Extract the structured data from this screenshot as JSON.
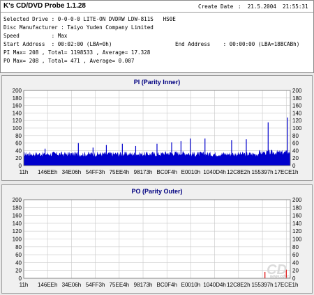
{
  "header": {
    "app_title": "K's CD/DVD Probe 1.1.28",
    "create_date_label": "Create Date",
    "create_date_value": ":  21.5.2004  21:55:31",
    "selected_drive": "Selected Drive : 0-0-0-0 LITE-ON DVDRW LDW-811S   HS0E",
    "disc_manufacturer": "Disc Manufacturer : Taiyo Yuden Company Limited",
    "speed": "Speed          : Max",
    "start_address": "Start Address  : 00:02:00 (LBA=0h)",
    "end_address": "End Address    : 00:00:00 (LBA=18BCABh)",
    "pi_stats": "PI Max= 208 , Total= 1198533 , Average= 17.328",
    "po_stats": "PO Max= 208 , Total= 471 , Average= 0.007"
  },
  "watermark": {
    "logo": "CD",
    "url": "www.cdr.cz"
  },
  "chart_data": [
    {
      "type": "area",
      "title": "PI (Parity Inner)",
      "xlabel": "",
      "ylabel": "",
      "ylim": [
        0,
        200
      ],
      "yticks": [
        0,
        20,
        40,
        60,
        80,
        100,
        120,
        140,
        160,
        180,
        200
      ],
      "x_tick_labels": [
        "11h",
        "146EEh",
        "34E06h",
        "54FF3h",
        "75EE4h",
        "98173h",
        "BC0F4h",
        "E0010h",
        "1040D4h",
        "12C8E2h",
        "155397h",
        "17ECE1h"
      ],
      "grid": true,
      "color": "#0000cc",
      "baseline_level": 32,
      "spikes": [
        {
          "x": 0.08,
          "value": 45
        },
        {
          "x": 0.205,
          "value": 60
        },
        {
          "x": 0.26,
          "value": 48
        },
        {
          "x": 0.31,
          "value": 55
        },
        {
          "x": 0.37,
          "value": 58
        },
        {
          "x": 0.42,
          "value": 52
        },
        {
          "x": 0.5,
          "value": 58
        },
        {
          "x": 0.555,
          "value": 62
        },
        {
          "x": 0.59,
          "value": 65
        },
        {
          "x": 0.625,
          "value": 72
        },
        {
          "x": 0.68,
          "value": 72
        },
        {
          "x": 0.78,
          "value": 68
        },
        {
          "x": 0.835,
          "value": 70
        },
        {
          "x": 0.917,
          "value": 115
        },
        {
          "x": 0.99,
          "value": 128
        }
      ]
    },
    {
      "type": "area",
      "title": "PO (Parity Outer)",
      "xlabel": "",
      "ylabel": "",
      "ylim": [
        0,
        200
      ],
      "yticks": [
        0,
        20,
        40,
        60,
        80,
        100,
        120,
        140,
        160,
        180,
        200
      ],
      "x_tick_labels": [
        "11h",
        "146EEh",
        "34E06h",
        "54FF3h",
        "75EE4h",
        "98173h",
        "BC0F4h",
        "E0010h",
        "1040D4h",
        "12C8E2h",
        "155397h",
        "17ECE1h"
      ],
      "grid": true,
      "color": "#dd0000",
      "spikes": [
        {
          "x": 0.905,
          "value": 16
        },
        {
          "x": 0.985,
          "value": 22
        }
      ]
    }
  ]
}
